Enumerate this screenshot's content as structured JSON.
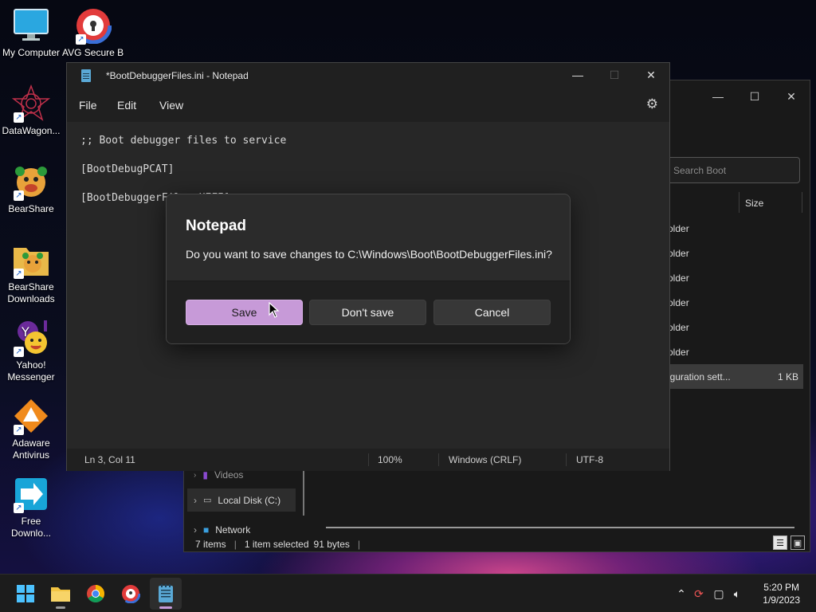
{
  "desktop": {
    "icons": [
      {
        "label": "My Computer",
        "icon": "monitor-icon"
      },
      {
        "label": "AVG Secure B...",
        "icon": "avg-browser-icon"
      },
      {
        "label": "DataWagon...",
        "icon": "datawagon-icon"
      },
      {
        "label": "BearShare",
        "icon": "bearshare-icon"
      },
      {
        "label": "BearShare Downloads",
        "icon": "folder-icon"
      },
      {
        "label": "Yahoo! Messenger",
        "icon": "yahoo-messenger-icon"
      },
      {
        "label": "Adaware Antivirus",
        "icon": "adaware-icon"
      },
      {
        "label": "Free Downlo...",
        "icon": "download-arrow-icon"
      }
    ]
  },
  "explorer": {
    "search_placeholder": "Search Boot",
    "column_size": "Size",
    "rows": [
      {
        "type": "older",
        "size": ""
      },
      {
        "type": "older",
        "size": ""
      },
      {
        "type": "older",
        "size": ""
      },
      {
        "type": "older",
        "size": ""
      },
      {
        "type": "older",
        "size": ""
      },
      {
        "type": "older",
        "size": ""
      },
      {
        "type": "iguration sett...",
        "size": "1 KB"
      }
    ],
    "nav": {
      "videos": "Videos",
      "local_disk": "Local Disk (C:)",
      "network": "Network"
    },
    "status": {
      "items": "7 items",
      "selected": "1 item selected",
      "size": "91 bytes"
    }
  },
  "notepad": {
    "title": "*BootDebuggerFiles.ini - Notepad",
    "menu": {
      "file": "File",
      "edit": "Edit",
      "view": "View"
    },
    "lines": [
      ";; Boot debugger files to service",
      "[BootDebugPCAT]",
      "[BootDebuggerFiles.UEFI]"
    ],
    "status": {
      "position": "Ln 3, Col 11",
      "zoom": "100%",
      "line_endings": "Windows (CRLF)",
      "encoding": "UTF-8"
    }
  },
  "dialog": {
    "title": "Notepad",
    "message": "Do you want to save changes to C:\\Windows\\Boot\\BootDebuggerFiles.ini?",
    "save_label": "Save",
    "dont_save_label": "Don't save",
    "cancel_label": "Cancel"
  },
  "taskbar": {
    "clock": {
      "time": "5:20 PM",
      "date": "1/9/2023"
    }
  },
  "colors": {
    "accent": "#c79ad8",
    "window_bg": "#272727",
    "titlebar_bg": "#202020",
    "taskbar_bg": "#1c1c1c"
  }
}
